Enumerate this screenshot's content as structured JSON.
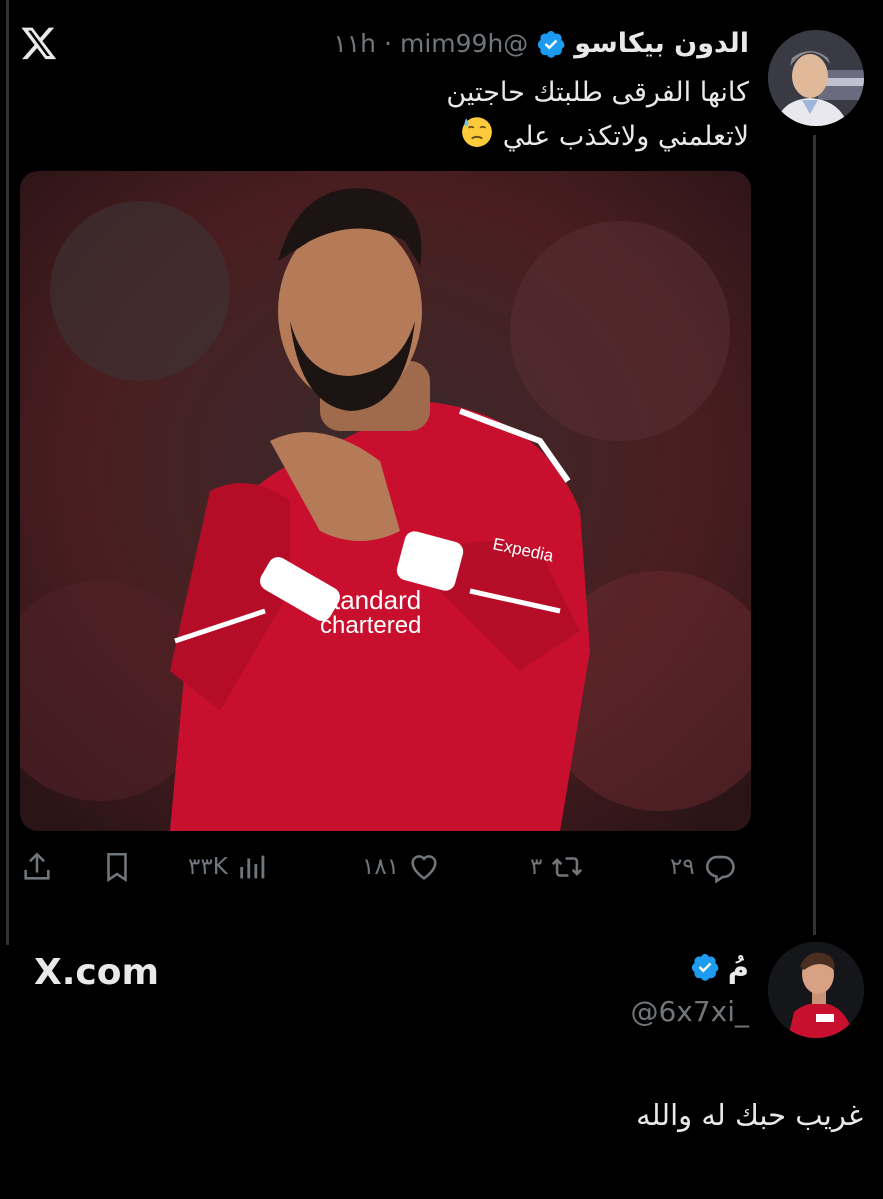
{
  "tweet": {
    "display_name": "الدون بيكاسو",
    "handle": "@mim99h",
    "separator": "·",
    "time": "١١h",
    "verified": true,
    "line1": "كانها الفرقى طلبتك حاجتين",
    "line2": "لاتعلمني ولاتكذب علي",
    "emoji": "downcast-face-with-sweat-icon",
    "media_alt": "Player in red kit applauding"
  },
  "actions": {
    "replies": "٢٩",
    "reposts": "٣",
    "likes": "١٨١",
    "views": "٣٣K"
  },
  "footer": {
    "site": "X.com",
    "reply_name": "مُ",
    "reply_handle": "@6x7xi_",
    "comment": "غريب حبك له والله"
  },
  "colors": {
    "background": "#000000",
    "text": "#e7e9ea",
    "muted": "#71767b",
    "verified": "#1d9bf0",
    "kit_red": "#c8102e"
  }
}
